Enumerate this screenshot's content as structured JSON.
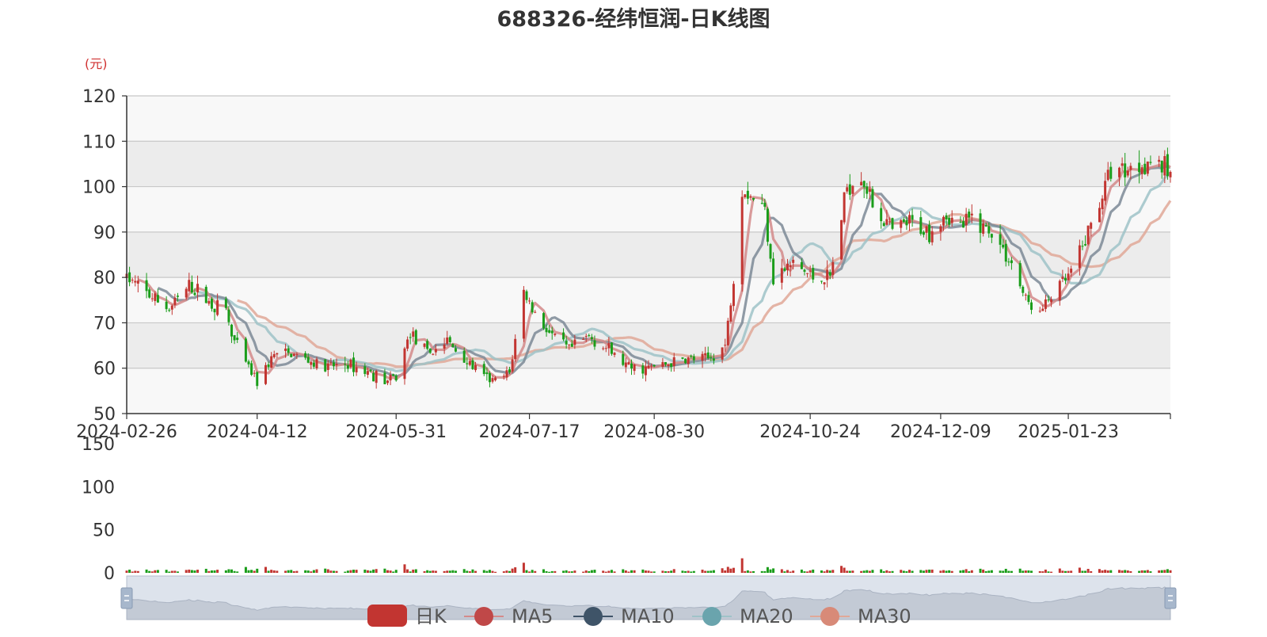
{
  "chart_data": {
    "type": "candlestick",
    "title": "688326-经纬恒润-日K线图",
    "unit_label": "(元)",
    "ylim": [
      50,
      120
    ],
    "y_ticks": [
      50,
      60,
      70,
      80,
      90,
      100,
      110,
      120
    ],
    "x_range": [
      "2024-02-26",
      "2025-02-28"
    ],
    "x_tick_labels": [
      "2024-02-26",
      "2024-04-12",
      "2024-05-31",
      "2024-07-17",
      "2024-08-30",
      "2024-10-24",
      "2024-12-09",
      "2025-01-23"
    ],
    "volume_ticks": [
      0,
      50,
      100,
      150
    ],
    "colors": {
      "up": "#c23531",
      "down": "#1a9d1a",
      "ma5": "#d48a8a",
      "ma10": "#7d8a96",
      "ma20": "#9fc3c8",
      "ma30": "#e0a898",
      "band_dark": "#ececec",
      "band_light": "#f8f8f8",
      "gridline": "#c8c8c8",
      "unit_color": "#d03030",
      "slider_fill": "#dde3ec",
      "slider_area": "#c3cad5"
    },
    "legend": [
      {
        "label": "日K",
        "series": "kline"
      },
      {
        "label": "MA5",
        "series": "ma5"
      },
      {
        "label": "MA10",
        "series": "ma10"
      },
      {
        "label": "MA20",
        "series": "ma20"
      },
      {
        "label": "MA30",
        "series": "ma30"
      }
    ],
    "price_anchors": [
      [
        "2024-02-26",
        80
      ],
      [
        "2024-03-05",
        76
      ],
      [
        "2024-03-12",
        73
      ],
      [
        "2024-03-19",
        78
      ],
      [
        "2024-03-22",
        77
      ],
      [
        "2024-03-27",
        74
      ],
      [
        "2024-04-01",
        73
      ],
      [
        "2024-04-03",
        67
      ],
      [
        "2024-04-08",
        61
      ],
      [
        "2024-04-12",
        57
      ],
      [
        "2024-04-18",
        63
      ],
      [
        "2024-04-25",
        63
      ],
      [
        "2024-05-06",
        60
      ],
      [
        "2024-05-13",
        61
      ],
      [
        "2024-05-22",
        59
      ],
      [
        "2024-05-28",
        57
      ],
      [
        "2024-05-31",
        58
      ],
      [
        "2024-06-05",
        68
      ],
      [
        "2024-06-11",
        63
      ],
      [
        "2024-06-18",
        66
      ],
      [
        "2024-06-24",
        62
      ],
      [
        "2024-07-01",
        58
      ],
      [
        "2024-07-05",
        57
      ],
      [
        "2024-07-10",
        59
      ],
      [
        "2024-07-15",
        77
      ],
      [
        "2024-07-18",
        73
      ],
      [
        "2024-07-25",
        67
      ],
      [
        "2024-07-31",
        64
      ],
      [
        "2024-08-07",
        67
      ],
      [
        "2024-08-14",
        64
      ],
      [
        "2024-08-21",
        60
      ],
      [
        "2024-08-28",
        60
      ],
      [
        "2024-09-04",
        61
      ],
      [
        "2024-09-11",
        62
      ],
      [
        "2024-09-18",
        62
      ],
      [
        "2024-09-24",
        65
      ],
      [
        "2024-09-27",
        80
      ],
      [
        "2024-09-30",
        100
      ],
      [
        "2024-10-08",
        95
      ],
      [
        "2024-10-11",
        80
      ],
      [
        "2024-10-18",
        83
      ],
      [
        "2024-10-25",
        80
      ],
      [
        "2024-10-31",
        80
      ],
      [
        "2024-11-06",
        100
      ],
      [
        "2024-11-11",
        103
      ],
      [
        "2024-11-15",
        96
      ],
      [
        "2024-11-22",
        90
      ],
      [
        "2024-11-28",
        92
      ],
      [
        "2024-12-05",
        90
      ],
      [
        "2024-12-10",
        94
      ],
      [
        "2024-12-16",
        91
      ],
      [
        "2024-12-20",
        93
      ],
      [
        "2024-12-27",
        90
      ],
      [
        "2025-01-03",
        83
      ],
      [
        "2025-01-08",
        75
      ],
      [
        "2025-01-13",
        72
      ],
      [
        "2025-01-17",
        76
      ],
      [
        "2025-01-23",
        80
      ],
      [
        "2025-01-27",
        85
      ],
      [
        "2025-02-05",
        100
      ],
      [
        "2025-02-07",
        104
      ],
      [
        "2025-02-14",
        104
      ],
      [
        "2025-02-21",
        106
      ],
      [
        "2025-02-28",
        103
      ]
    ]
  }
}
